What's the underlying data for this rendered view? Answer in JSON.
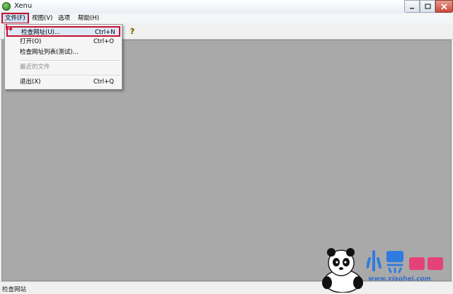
{
  "window": {
    "title": "Xenu",
    "caption_buttons": [
      "minimize",
      "maximize",
      "close"
    ]
  },
  "menubar": {
    "items": [
      "文件(F)",
      "视图(V)",
      "选项",
      "帮助(H)"
    ]
  },
  "toolbar": {
    "help_glyph": "?"
  },
  "dropdown": {
    "items": [
      {
        "label": "检查网址(U)...",
        "shortcut": "Ctrl+N",
        "highlighted": true
      },
      {
        "label": "打开(O)",
        "shortcut": "Ctrl+O"
      },
      {
        "label": "检查网址列表(测试)...",
        "shortcut": ""
      },
      {
        "label": "最近的文件",
        "shortcut": "",
        "disabled": true
      },
      {
        "label": "退出(X)",
        "shortcut": "Ctrl+Q"
      }
    ]
  },
  "statusbar": {
    "text": "检查网站"
  },
  "watermark": {
    "text": "www.xiaohei.com",
    "logo": "小黑游戏"
  },
  "colors": {
    "highlight_border": "#c8102e",
    "workspace": "#a9a9a9",
    "menu_highlight": "#dce9f7"
  }
}
